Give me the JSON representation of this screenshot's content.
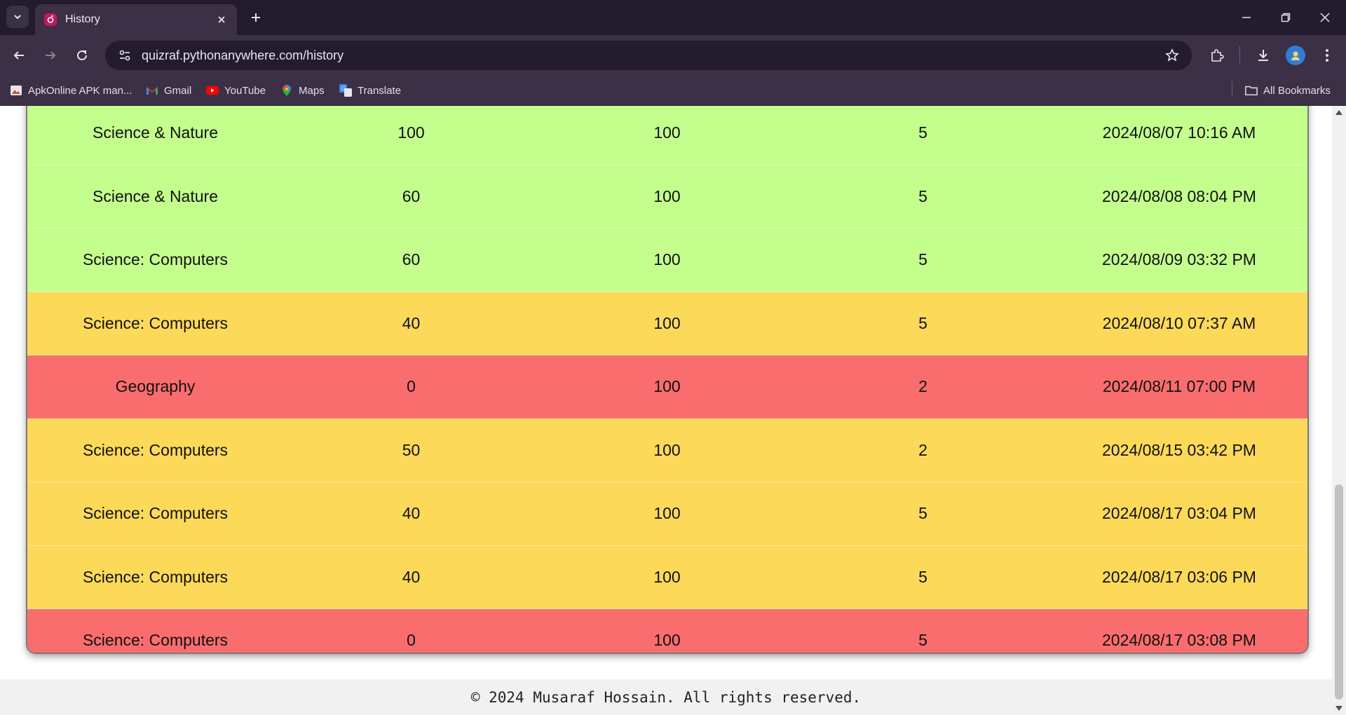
{
  "browser": {
    "tab_title": "History",
    "url": "quizraf.pythonanywhere.com/history",
    "bookmarks": [
      {
        "label": "ApkOnline APK man...",
        "icon": "apkonline-icon"
      },
      {
        "label": "Gmail",
        "icon": "gmail-icon"
      },
      {
        "label": "YouTube",
        "icon": "youtube-icon"
      },
      {
        "label": "Maps",
        "icon": "maps-icon"
      },
      {
        "label": "Translate",
        "icon": "translate-icon"
      }
    ],
    "all_bookmarks_label": "All Bookmarks"
  },
  "history": {
    "row_colors": {
      "green": "#c4ff8e",
      "yellow": "#fdd95a",
      "red": "#f96d6e"
    },
    "rows": [
      {
        "category": "Science & Nature",
        "score": "100",
        "total": "100",
        "questions": "5",
        "date": "2024/08/07 10:16 AM",
        "status": "green"
      },
      {
        "category": "Science & Nature",
        "score": "60",
        "total": "100",
        "questions": "5",
        "date": "2024/08/08 08:04 PM",
        "status": "green"
      },
      {
        "category": "Science: Computers",
        "score": "60",
        "total": "100",
        "questions": "5",
        "date": "2024/08/09 03:32 PM",
        "status": "green"
      },
      {
        "category": "Science: Computers",
        "score": "40",
        "total": "100",
        "questions": "5",
        "date": "2024/08/10 07:37 AM",
        "status": "yellow"
      },
      {
        "category": "Geography",
        "score": "0",
        "total": "100",
        "questions": "2",
        "date": "2024/08/11 07:00 PM",
        "status": "red"
      },
      {
        "category": "Science: Computers",
        "score": "50",
        "total": "100",
        "questions": "2",
        "date": "2024/08/15 03:42 PM",
        "status": "yellow"
      },
      {
        "category": "Science: Computers",
        "score": "40",
        "total": "100",
        "questions": "5",
        "date": "2024/08/17 03:04 PM",
        "status": "yellow"
      },
      {
        "category": "Science: Computers",
        "score": "40",
        "total": "100",
        "questions": "5",
        "date": "2024/08/17 03:06 PM",
        "status": "yellow"
      },
      {
        "category": "Science: Computers",
        "score": "0",
        "total": "100",
        "questions": "5",
        "date": "2024/08/17 03:08 PM",
        "status": "red"
      }
    ]
  },
  "footer": {
    "text": "© 2024 Musaraf Hossain. All rights reserved."
  }
}
